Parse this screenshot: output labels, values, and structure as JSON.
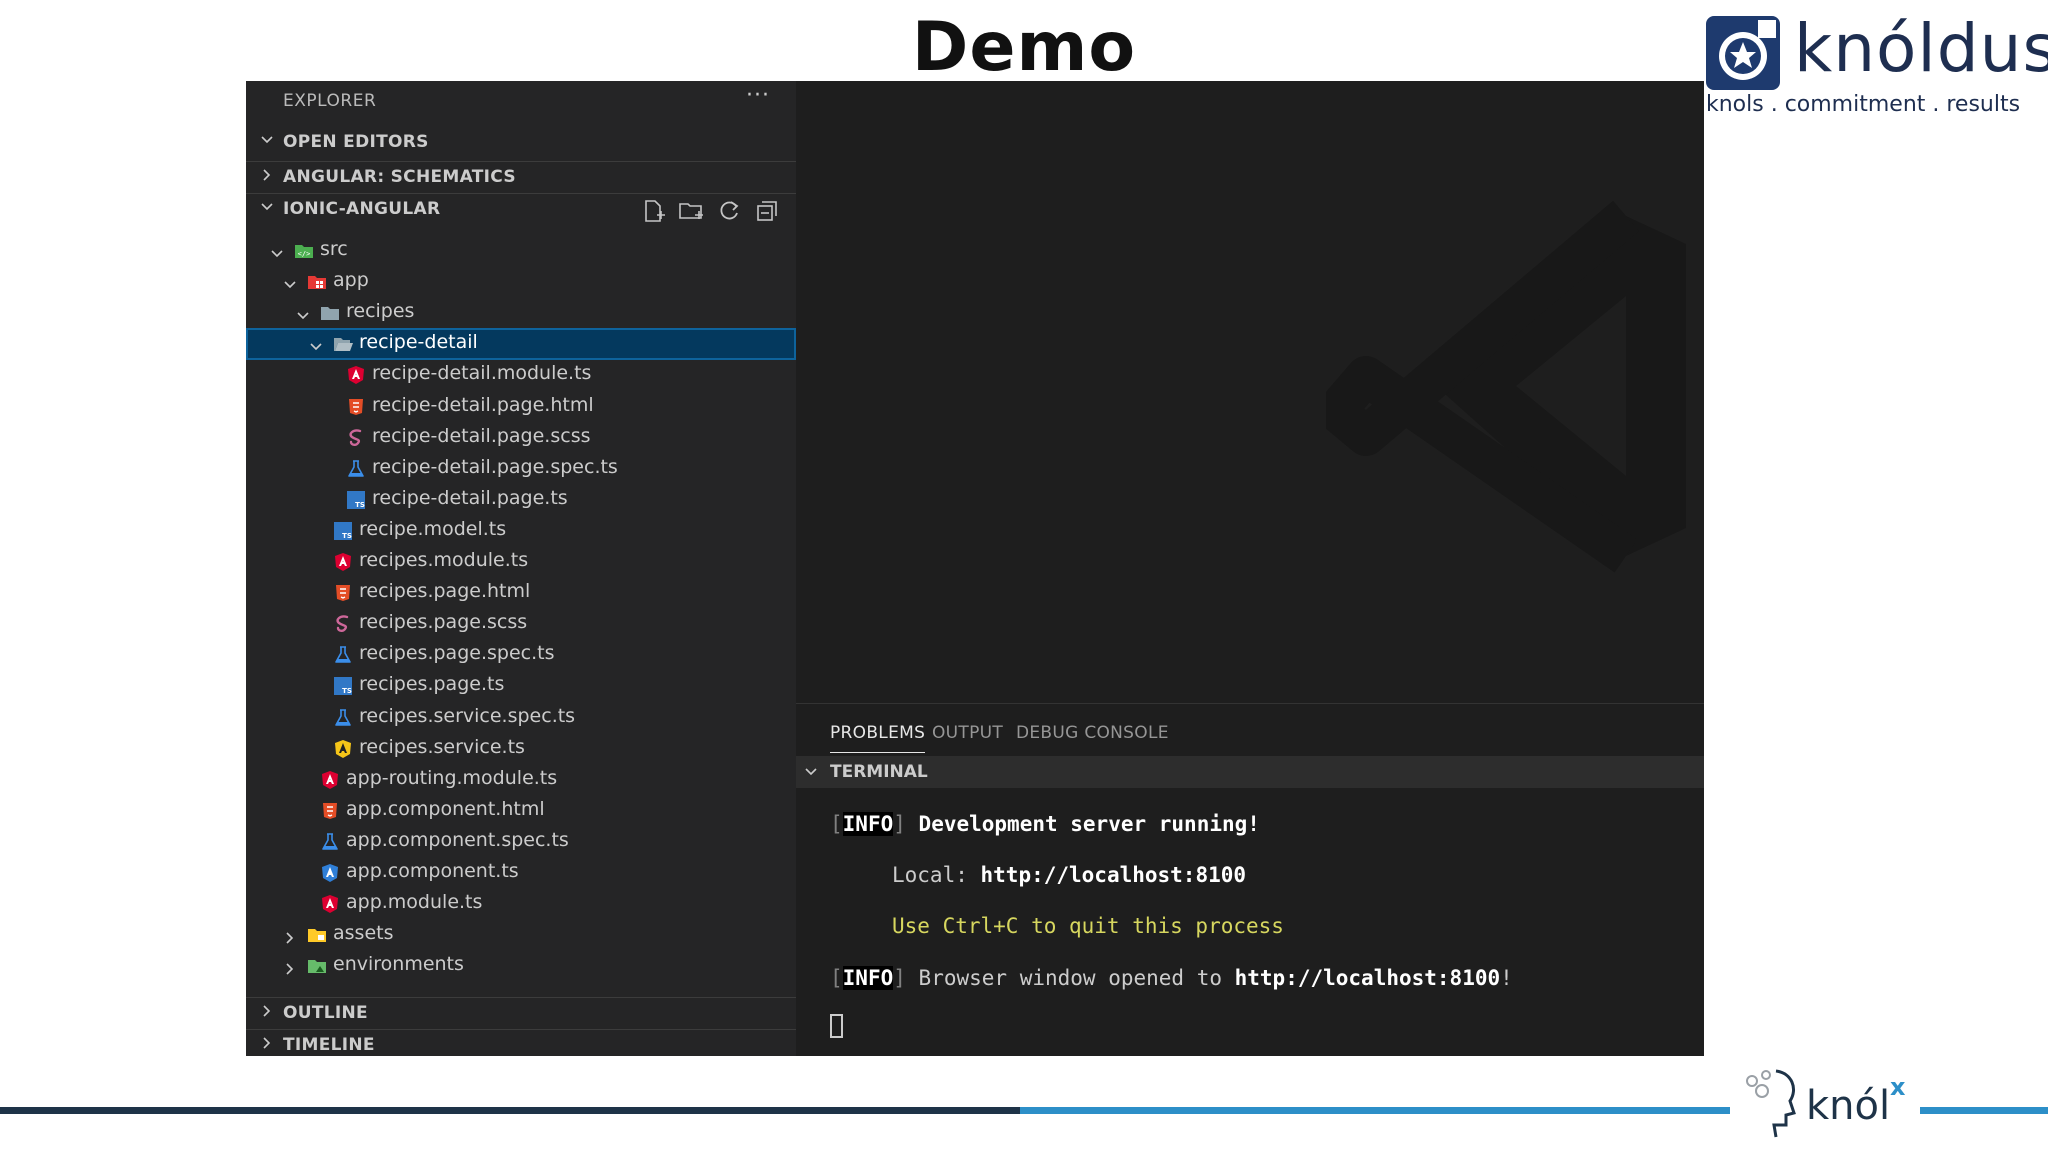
{
  "slide": {
    "title": "Demo",
    "logo_word": "knóldus",
    "logo_tagline": "knols . commitment . results",
    "footer_logo_word": "knól",
    "footer_logo_x": "x"
  },
  "explorer": {
    "header": "EXPLORER",
    "more": "···",
    "sections": {
      "open_editors": "OPEN EDITORS",
      "angular_schematics": "ANGULAR: SCHEMATICS",
      "project": "IONIC-ANGULAR",
      "outline": "OUTLINE",
      "timeline": "TIMELINE"
    },
    "tree": [
      {
        "label": "src",
        "depth": 0,
        "expanded": true,
        "icon": "folder-src-icon",
        "type": "folder"
      },
      {
        "label": "app",
        "depth": 1,
        "expanded": true,
        "icon": "folder-app-icon",
        "type": "folder"
      },
      {
        "label": "recipes",
        "depth": 2,
        "expanded": true,
        "icon": "folder-icon",
        "type": "folder"
      },
      {
        "label": "recipe-detail",
        "depth": 3,
        "expanded": true,
        "icon": "folder-open-icon",
        "type": "folder",
        "selected": true
      },
      {
        "label": "recipe-detail.module.ts",
        "depth": 4,
        "icon": "angular-icon",
        "type": "file"
      },
      {
        "label": "recipe-detail.page.html",
        "depth": 4,
        "icon": "html-icon",
        "type": "file"
      },
      {
        "label": "recipe-detail.page.scss",
        "depth": 4,
        "icon": "sass-icon",
        "type": "file"
      },
      {
        "label": "recipe-detail.page.spec.ts",
        "depth": 4,
        "icon": "test-flask-icon",
        "type": "file"
      },
      {
        "label": "recipe-detail.page.ts",
        "depth": 4,
        "icon": "typescript-icon",
        "type": "file"
      },
      {
        "label": "recipe.model.ts",
        "depth": 3,
        "icon": "typescript-icon",
        "type": "file"
      },
      {
        "label": "recipes.module.ts",
        "depth": 3,
        "icon": "angular-icon",
        "type": "file"
      },
      {
        "label": "recipes.page.html",
        "depth": 3,
        "icon": "html-icon",
        "type": "file"
      },
      {
        "label": "recipes.page.scss",
        "depth": 3,
        "icon": "sass-icon",
        "type": "file"
      },
      {
        "label": "recipes.page.spec.ts",
        "depth": 3,
        "icon": "test-flask-icon",
        "type": "file"
      },
      {
        "label": "recipes.page.ts",
        "depth": 3,
        "icon": "typescript-icon",
        "type": "file"
      },
      {
        "label": "recipes.service.spec.ts",
        "depth": 3,
        "icon": "test-flask-icon",
        "type": "file"
      },
      {
        "label": "recipes.service.ts",
        "depth": 3,
        "icon": "angular-service-icon",
        "type": "file"
      },
      {
        "label": "app-routing.module.ts",
        "depth": 2,
        "icon": "angular-icon",
        "type": "file"
      },
      {
        "label": "app.component.html",
        "depth": 2,
        "icon": "html-icon",
        "type": "file"
      },
      {
        "label": "app.component.spec.ts",
        "depth": 2,
        "icon": "test-flask-icon",
        "type": "file"
      },
      {
        "label": "app.component.ts",
        "depth": 2,
        "icon": "angular-component-icon",
        "type": "file"
      },
      {
        "label": "app.module.ts",
        "depth": 2,
        "icon": "angular-icon",
        "type": "file"
      },
      {
        "label": "assets",
        "depth": 1,
        "expanded": false,
        "icon": "folder-assets-icon",
        "type": "folder"
      },
      {
        "label": "environments",
        "depth": 1,
        "expanded": false,
        "icon": "folder-environment-icon",
        "type": "folder"
      }
    ]
  },
  "panel": {
    "tabs": [
      "PROBLEMS",
      "OUTPUT",
      "DEBUG CONSOLE"
    ],
    "active_tab": "PROBLEMS",
    "terminal_label": "TERMINAL",
    "lines": {
      "l1_tag": "INFO",
      "l1_text": "Development server running!",
      "l2_prefix": "Local: ",
      "l2_url": "http://localhost:8100",
      "l3_text": "Use Ctrl+C to quit this process",
      "l4_tag": "INFO",
      "l4_text": "Browser window opened to ",
      "l4_url": "http://localhost:8100",
      "l4_suffix": "!"
    }
  },
  "colors": {
    "angular": "#dd0031",
    "html": "#e44d26",
    "sass": "#cd6799",
    "test": "#3b8eea",
    "typescript": "#3178c6",
    "service": "#f5c518",
    "component": "#2f7fd8",
    "folder": "#90a4ae",
    "selection": "#04395e"
  }
}
